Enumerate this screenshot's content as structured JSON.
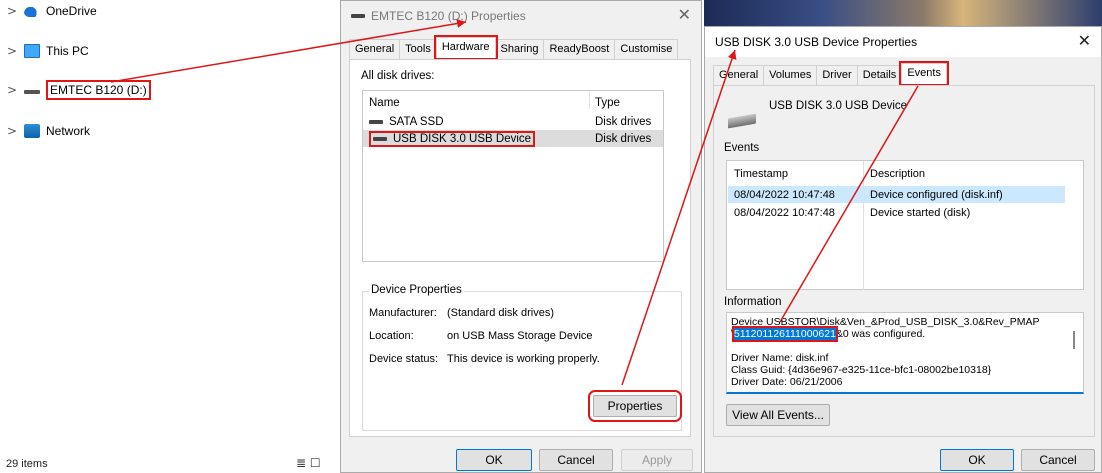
{
  "explorer": {
    "nav": [
      {
        "label": "OneDrive"
      },
      {
        "label": "This PC"
      },
      {
        "label": "EMTEC B120 (D:)"
      },
      {
        "label": "Network"
      }
    ],
    "item_count": "29 items"
  },
  "drive_dialog": {
    "title": "EMTEC B120 (D:) Properties",
    "tabs": [
      "General",
      "Tools",
      "Hardware",
      "Sharing",
      "ReadyBoost",
      "Customise"
    ],
    "active_tab": "Hardware",
    "all_disk_label": "All disk drives:",
    "columns": [
      "Name",
      "Type"
    ],
    "drives": [
      {
        "name": "SATA SSD",
        "type": "Disk drives"
      },
      {
        "name": "USB DISK 3.0 USB Device",
        "type": "Disk drives"
      }
    ],
    "device_props": {
      "title": "Device Properties",
      "manufacturer_label": "Manufacturer:",
      "manufacturer": "(Standard disk drives)",
      "location_label": "Location:",
      "location": "on USB Mass Storage Device",
      "status_label": "Device status:",
      "status": "This device is working properly."
    },
    "properties_btn": "Properties",
    "ok": "OK",
    "cancel": "Cancel",
    "apply": "Apply"
  },
  "usb_dialog": {
    "title": "USB DISK 3.0 USB Device Properties",
    "tabs": [
      "General",
      "Volumes",
      "Driver",
      "Details",
      "Events"
    ],
    "active_tab": "Events",
    "device_name": "USB DISK 3.0 USB Device",
    "events_label": "Events",
    "columns": [
      "Timestamp",
      "Description"
    ],
    "events": [
      {
        "timestamp": "08/04/2022 10:47:48",
        "description": "Device configured (disk.inf)"
      },
      {
        "timestamp": "08/04/2022 10:47:48",
        "description": "Device started (disk)"
      }
    ],
    "info_label": "Information",
    "info": {
      "line1": "Device USBSTOR\\Disk&Ven_&Prod_USB_DISK_3.0&Rev_PMAP",
      "line2_prefix": "\\",
      "serial": "511201126111000621",
      "line2_suffix": "&0 was configured.",
      "driver_name": "Driver Name: disk.inf",
      "class_guid": "Class Guid: {4d36e967-e325-11ce-bfc1-08002be10318}",
      "driver_date": "Driver Date: 06/21/2006"
    },
    "view_all": "View All Events...",
    "ok": "OK",
    "cancel": "Cancel"
  },
  "annotation_color": "#e01515"
}
